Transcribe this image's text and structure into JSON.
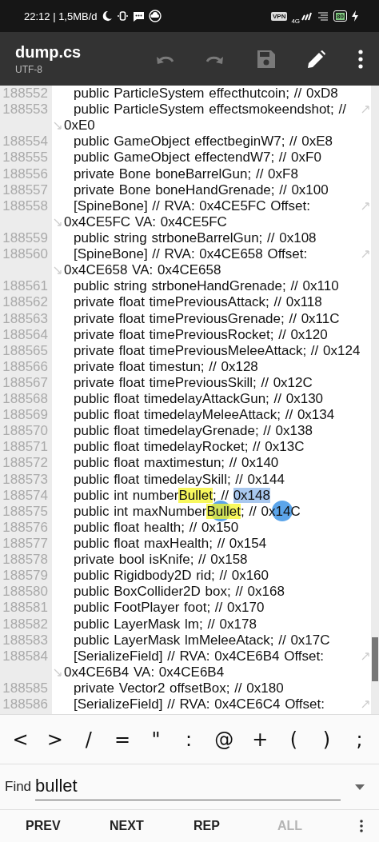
{
  "status_bar": {
    "time": "22:12 | 1,5MB/d",
    "vpn": "VPN",
    "network": "4G",
    "battery": "80"
  },
  "toolbar": {
    "title": "dump.cs",
    "subtitle": "UTF-8",
    "actions": [
      {
        "kind": "undo",
        "disabled": true
      },
      {
        "kind": "redo",
        "disabled": true
      },
      {
        "kind": "save",
        "disabled": true
      },
      {
        "kind": "edit",
        "disabled": false
      },
      {
        "kind": "more",
        "disabled": false
      }
    ]
  },
  "lines": [
    {
      "number": "188552",
      "text": "public ParticleSystem effecthutcoin; // 0xD8",
      "wraps": false
    },
    {
      "number": "188553",
      "text": "public ParticleSystem effectsmokeendshot; //",
      "wraps": true,
      "continuation": "0xE0"
    },
    {
      "number": "188554",
      "text": "public GameObject effectbeginW7; // 0xE8",
      "wraps": false
    },
    {
      "number": "188555",
      "text": "public GameObject effectendW7; // 0xF0",
      "wraps": false
    },
    {
      "number": "188556",
      "text": "private Bone boneBarrelGun; // 0xF8",
      "wraps": false
    },
    {
      "number": "188557",
      "text": "private Bone boneHandGrenade; // 0x100",
      "wraps": false
    },
    {
      "number": "188558",
      "text": "[SpineBone] // RVA: 0x4CE5FC Offset:",
      "wraps": true,
      "continuation": "0x4CE5FC VA: 0x4CE5FC"
    },
    {
      "number": "188559",
      "text": "public string strboneBarrelGun; // 0x108",
      "wraps": false
    },
    {
      "number": "188560",
      "text": "[SpineBone] // RVA: 0x4CE658 Offset:",
      "wraps": true,
      "continuation": "0x4CE658 VA: 0x4CE658"
    },
    {
      "number": "188561",
      "text": "public string strboneHandGrenade; // 0x110",
      "wraps": false
    },
    {
      "number": "188562",
      "text": "private float timePreviousAttack; // 0x118",
      "wraps": false
    },
    {
      "number": "188563",
      "text": "private float timePreviousGrenade; // 0x11C",
      "wraps": false
    },
    {
      "number": "188564",
      "text": "private float timePreviousRocket; // 0x120",
      "wraps": false
    },
    {
      "number": "188565",
      "text": "private float timePreviousMeleeAttack; // 0x124",
      "wraps": false
    },
    {
      "number": "188566",
      "text": "private float timestun; // 0x128",
      "wraps": false
    },
    {
      "number": "188567",
      "text": "private float timePreviousSkill; // 0x12C",
      "wraps": false
    },
    {
      "number": "188568",
      "text": "public float timedelayAttackGun; // 0x130",
      "wraps": false
    },
    {
      "number": "188569",
      "text": "public float timedelayMeleeAttack; // 0x134",
      "wraps": false
    },
    {
      "number": "188570",
      "text": "public float timedelayGrenade; // 0x138",
      "wraps": false
    },
    {
      "number": "188571",
      "text": "public float timedelayRocket; // 0x13C",
      "wraps": false
    },
    {
      "number": "188572",
      "text": "public float maxtimestun; // 0x140",
      "wraps": false
    },
    {
      "number": "188573",
      "text": "public float timedelaySkill; // 0x144",
      "wraps": false
    },
    {
      "number": "188574",
      "wraps": false,
      "segments": [
        {
          "text": "public int number",
          "match": false,
          "selected": false
        },
        {
          "text": "Bullet",
          "match": true,
          "selected": false
        },
        {
          "text": "; // ",
          "match": false,
          "selected": false
        },
        {
          "text": "0x148",
          "match": false,
          "selected": true
        }
      ]
    },
    {
      "number": "188575",
      "wraps": false,
      "segments": [
        {
          "text": "public int maxNumber",
          "match": false,
          "selected": false
        },
        {
          "text": "Bullet",
          "match": true,
          "selected": false
        },
        {
          "text": "; // 0x14C",
          "match": false,
          "selected": false
        }
      ]
    },
    {
      "number": "188576",
      "text": "public float health; // 0x150",
      "wraps": false
    },
    {
      "number": "188577",
      "text": "public float maxHealth; // 0x154",
      "wraps": false
    },
    {
      "number": "188578",
      "text": "private bool isKnife; // 0x158",
      "wraps": false
    },
    {
      "number": "188579",
      "text": "public Rigidbody2D rid; // 0x160",
      "wraps": false
    },
    {
      "number": "188580",
      "text": "public BoxCollider2D box; // 0x168",
      "wraps": false
    },
    {
      "number": "188581",
      "text": "public FootPlayer foot; // 0x170",
      "wraps": false
    },
    {
      "number": "188582",
      "text": "public LayerMask lm; // 0x178",
      "wraps": false
    },
    {
      "number": "188583",
      "text": "public LayerMask lmMeleeAtack; // 0x17C",
      "wraps": false
    },
    {
      "number": "188584",
      "text": "[SerializeField] // RVA: 0x4CE6B4 Offset:",
      "wraps": true,
      "continuation": "0x4CE6B4 VA: 0x4CE6B4"
    },
    {
      "number": "188585",
      "text": "private Vector2 offsetBox; // 0x180",
      "wraps": false
    },
    {
      "number": "188586",
      "text": "[SerializeField] // RVA: 0x4CE6C4 Offset:",
      "wraps": true
    }
  ],
  "symbols": [
    "<",
    ">",
    "/",
    "=",
    "\"",
    ":",
    "@",
    "+",
    "(",
    ")",
    ";"
  ],
  "find": {
    "label": "Find",
    "value": "bullet"
  },
  "actions": [
    {
      "label": "PREV",
      "disabled": false
    },
    {
      "label": "NEXT",
      "disabled": false
    },
    {
      "label": "REP",
      "disabled": false
    },
    {
      "label": "ALL",
      "disabled": true
    }
  ]
}
